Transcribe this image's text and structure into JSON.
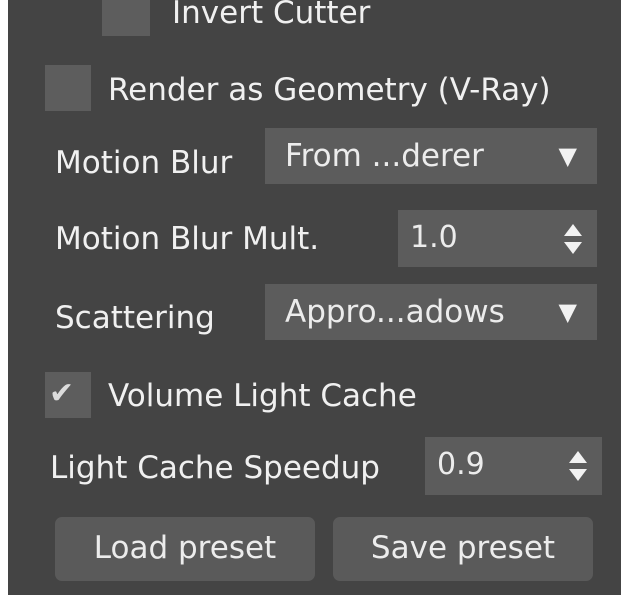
{
  "panel": {
    "invert_cutter": {
      "label": "Invert Cutter",
      "checked": false
    },
    "render_as_geometry": {
      "label": "Render as Geometry (V-Ray)",
      "checked": false
    },
    "motion_blur": {
      "label": "Motion Blur",
      "value": "From ...derer"
    },
    "motion_blur_mult": {
      "label": "Motion Blur Mult.",
      "value": "1.0"
    },
    "scattering": {
      "label": "Scattering",
      "value": "Appro...adows"
    },
    "volume_light_cache": {
      "label": "Volume Light Cache",
      "checked": true
    },
    "light_cache_speedup": {
      "label": "Light Cache Speedup",
      "value": "0.9"
    },
    "buttons": {
      "load_label": "Load preset",
      "save_label": "Save preset"
    }
  },
  "icons": {
    "checkmark": "check-icon",
    "dropdown": "triangle-down-icon",
    "spinner": "spinner-arrows-icon"
  },
  "colors": {
    "panel_bg": "#444444",
    "control_bg": "#5c5c5c",
    "text": "#f0f0f0"
  }
}
